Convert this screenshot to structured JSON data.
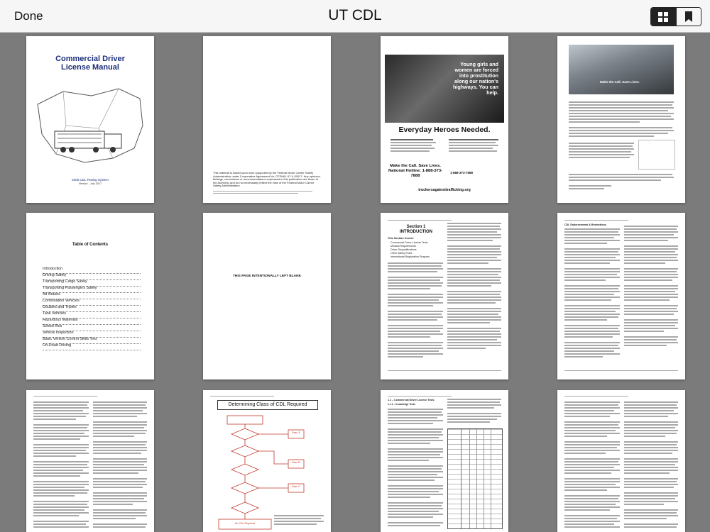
{
  "toolbar": {
    "done_label": "Done",
    "title": "UT CDL",
    "grid_icon": "grid-icon",
    "bookmark_icon": "bookmark-icon"
  },
  "pages": {
    "p1": {
      "title": "Commercial Driver License Manual",
      "footer_line1": "2005 CDL Testing System",
      "footer_line2": "Version - July 2017"
    },
    "p2": {
      "notice": "This material is based upon work supported by the Federal Motor Carrier Safety Administration under Cooperative Agreement No. DTFH61-97-X-00017. Any opinions, findings, conclusions or recommendations expressed in this publication are those of the Author(s) and do not necessarily reflect the view of the Federal Motor Carrier Safety Administration."
    },
    "p3": {
      "poster_text": "Young girls and women are forced into prostitution along our nation's highways. You can help.",
      "slogan": "Everyday Heroes Needed.",
      "call": "Make the Call. Save Lives. National Hotline: 1-888-373-7888",
      "phone": "1-888-373-7888",
      "website": "truckersagainsttrafficking.org"
    },
    "p4": {
      "banner": "Make the Call. Save Lives."
    },
    "p5": {
      "title": "Table of Contents",
      "entries": [
        "Introduction",
        "Driving Safely",
        "Transporting Cargo Safely",
        "Transporting Passengers Safely",
        "Air Brakes",
        "Combination Vehicles",
        "Doubles and Triples",
        "Tank Vehicles",
        "Hazardous Materials",
        "School Bus",
        "Vehicle Inspection",
        "Basic Vehicle Control Skills Test",
        "On-Road Driving"
      ]
    },
    "p6": {
      "text": "THIS PAGE INTENTIONALLY LEFT BLANK"
    },
    "p7": {
      "section": "Section 1",
      "heading": "INTRODUCTION",
      "subheading": "This Section Covers",
      "bullets": [
        "Commercial Driver License Tests",
        "Medical Requirements",
        "Driver Disqualifications",
        "Other Safety Rules",
        "International Registration Program"
      ]
    },
    "p8": {
      "heading": "CDL Endorsements & Restrictions"
    },
    "p10": {
      "title": "Determining Class of CDL Required",
      "class_labels": [
        "Class 'A'",
        "Class 'B'",
        "Class 'C'",
        "No CDL Required"
      ]
    },
    "p11": {
      "heading": "1.1 – Commercial Driver License Tests"
    },
    "p12": {
      "heading": "1.1.1 – Knowledge Tests"
    }
  }
}
